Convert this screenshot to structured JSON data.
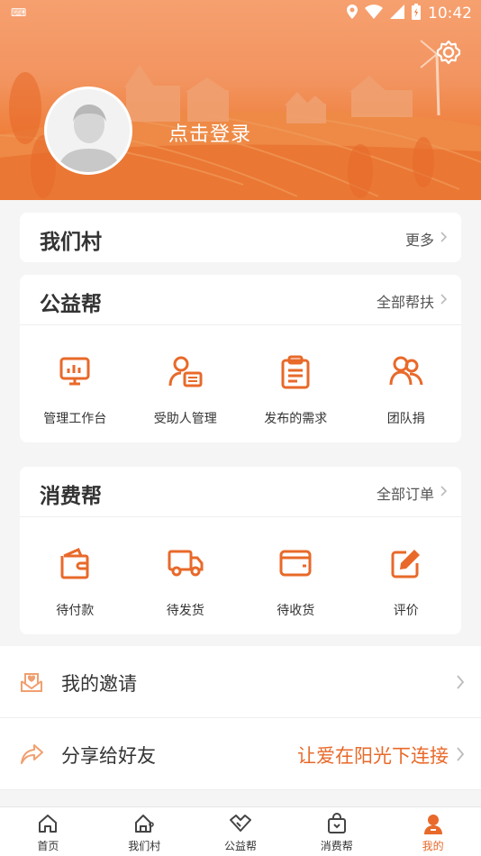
{
  "status": {
    "time": "10:42"
  },
  "profile": {
    "login_text": "点击登录"
  },
  "village": {
    "title": "我们村",
    "more": "更多"
  },
  "charity": {
    "title": "公益帮",
    "more": "全部帮扶",
    "items": [
      {
        "label": "管理工作台",
        "icon": "monitor-chart-icon"
      },
      {
        "label": "受助人管理",
        "icon": "person-card-icon"
      },
      {
        "label": "发布的需求",
        "icon": "clipboard-icon"
      },
      {
        "label": "团队捐",
        "icon": "team-icon"
      }
    ]
  },
  "consume": {
    "title": "消费帮",
    "more": "全部订单",
    "items": [
      {
        "label": "待付款",
        "icon": "wallet-icon"
      },
      {
        "label": "待发货",
        "icon": "truck-icon"
      },
      {
        "label": "待收货",
        "icon": "box-icon"
      },
      {
        "label": "评价",
        "icon": "edit-icon"
      }
    ]
  },
  "menu": {
    "invite": {
      "label": "我的邀请",
      "icon": "invite-envelope-icon"
    },
    "share": {
      "label": "分享给好友",
      "extra": "让爱在阳光下连接",
      "icon": "share-arrow-icon"
    }
  },
  "tabs": [
    {
      "label": "首页",
      "icon": "home-icon"
    },
    {
      "label": "我们村",
      "icon": "village-icon"
    },
    {
      "label": "公益帮",
      "icon": "handshake-icon"
    },
    {
      "label": "消费帮",
      "icon": "shopping-bag-icon"
    },
    {
      "label": "我的",
      "icon": "user-icon",
      "active": true
    }
  ],
  "colors": {
    "accent": "#e8692a",
    "header_top": "#f6a06f"
  }
}
